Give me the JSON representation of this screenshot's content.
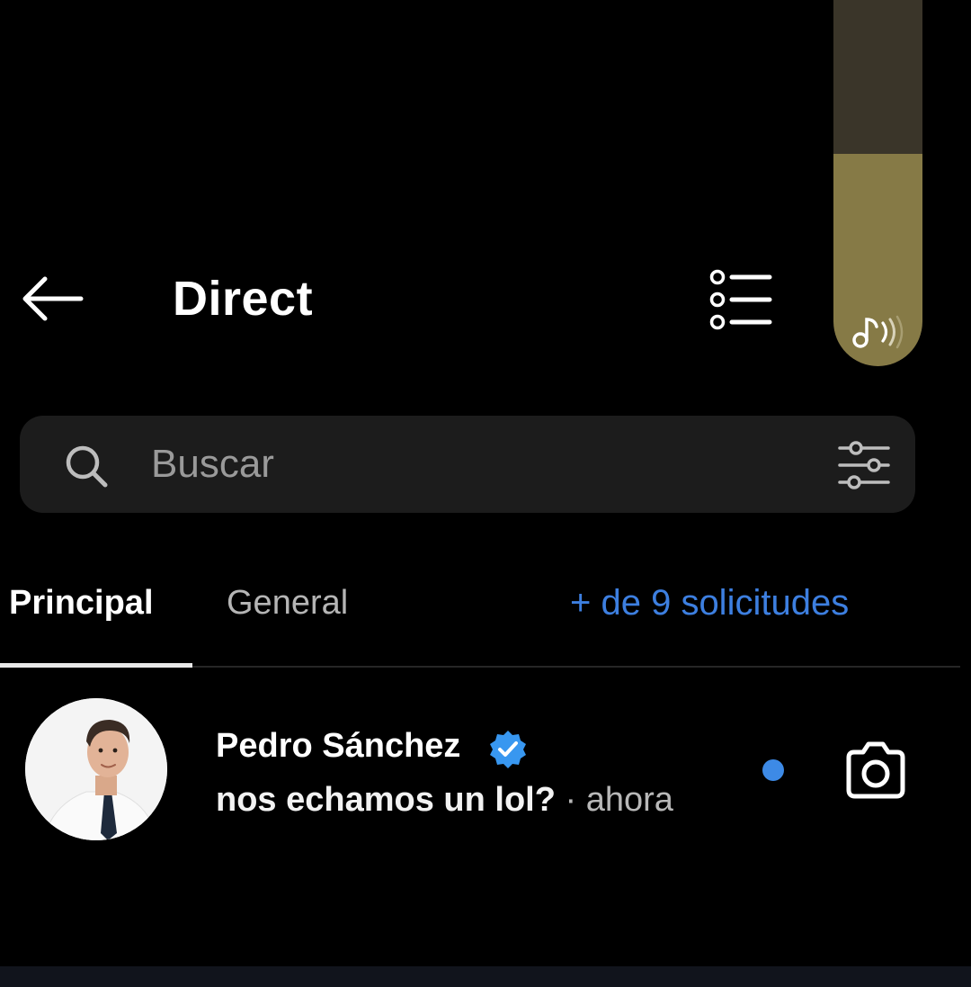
{
  "header": {
    "title": "Direct",
    "back_icon": "arrow-left-icon",
    "list_icon": "list-icon"
  },
  "volume": {
    "level": 0.58,
    "icon": "music-note-icon",
    "colors": {
      "track": "#3a3529",
      "fill": "#867a46"
    }
  },
  "search": {
    "placeholder": "Buscar",
    "value": "",
    "icon": "search-icon",
    "filter_icon": "filter-sliders-icon"
  },
  "tabs": [
    {
      "label": "Principal",
      "active": true
    },
    {
      "label": "General",
      "active": false
    }
  ],
  "requests_link": "+ de 9 solicitudes",
  "conversations": [
    {
      "name": "Pedro Sánchez",
      "verified": true,
      "message": "nos echamos un lol?",
      "separator": "·",
      "time": "ahora",
      "unread": true,
      "action_icon": "camera-icon"
    }
  ],
  "colors": {
    "background": "#000000",
    "accent_blue": "#3d7fe0",
    "verified_blue": "#3897f0",
    "search_bg": "#1c1c1c"
  }
}
